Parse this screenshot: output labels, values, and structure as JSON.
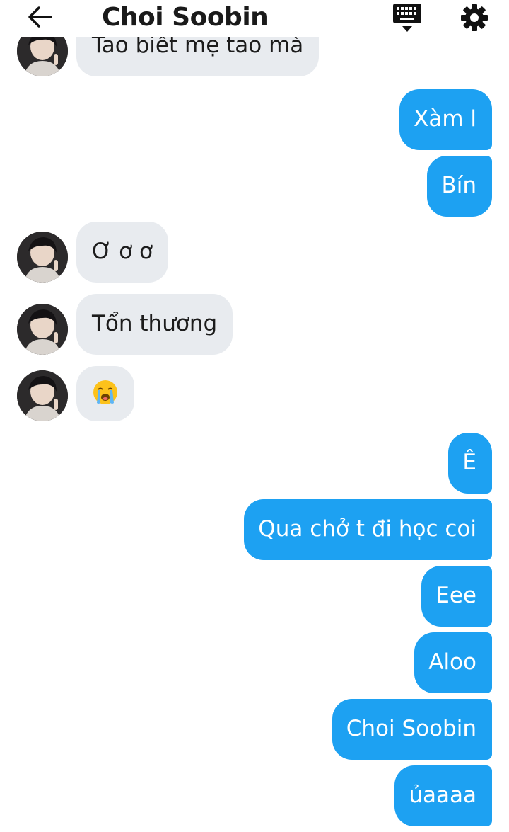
{
  "header": {
    "title": "Choi Soobin",
    "back_icon": "arrow-left-icon",
    "keyboard_icon": "keyboard-icon",
    "settings_icon": "gear-icon"
  },
  "colors": {
    "outgoing_bubble": "#1da1f2",
    "incoming_bubble": "#e8ebef",
    "background": "#ffffff"
  },
  "messages": [
    {
      "dir": "in",
      "text": "Tao biết mẹ tao mà",
      "avatar": true
    },
    {
      "dir": "out",
      "text": "Xàm l"
    },
    {
      "dir": "out",
      "text": "Bín"
    },
    {
      "dir": "in",
      "text": "Ơ ơ ơ",
      "avatar": true
    },
    {
      "dir": "in",
      "text": "Tổn thương",
      "avatar": true
    },
    {
      "dir": "in",
      "emoji": "loudly-crying-face",
      "avatar": true
    },
    {
      "dir": "out",
      "text": "Ê"
    },
    {
      "dir": "out",
      "text": "Qua chở t đi học coi"
    },
    {
      "dir": "out",
      "text": "Eee"
    },
    {
      "dir": "out",
      "text": "Aloo"
    },
    {
      "dir": "out",
      "text": "Choi Soobin"
    },
    {
      "dir": "out",
      "text": "ủaaaa"
    }
  ]
}
